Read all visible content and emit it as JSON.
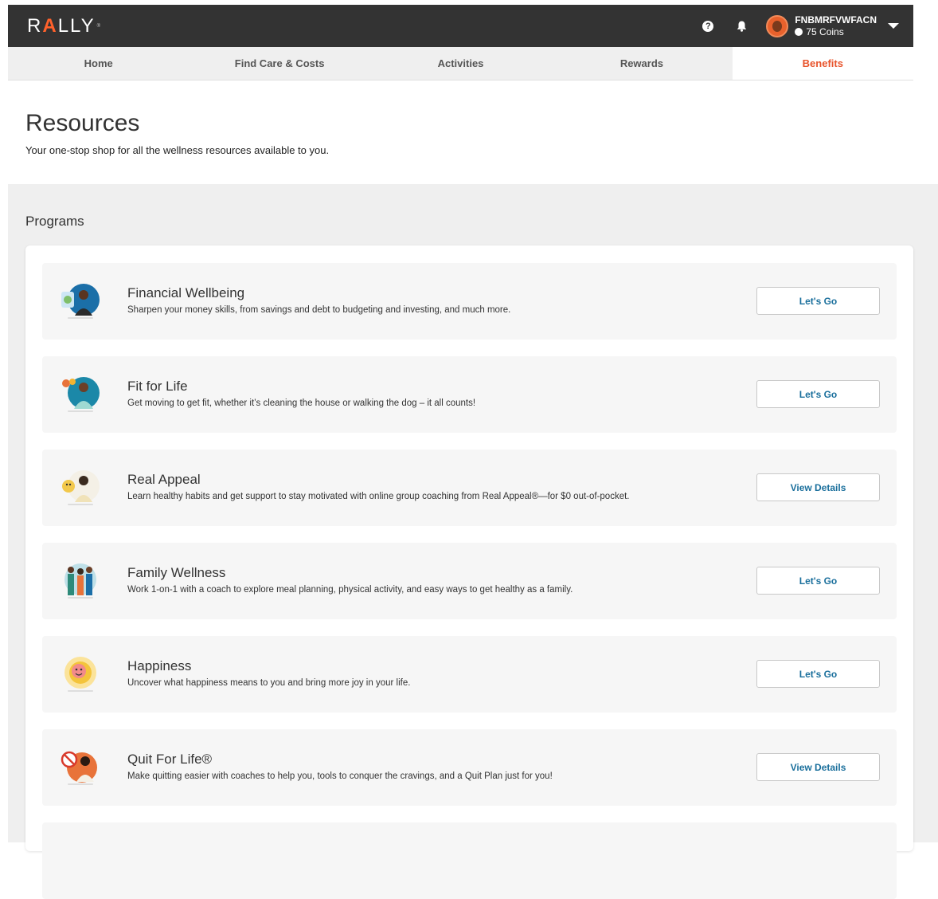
{
  "topbar": {
    "logo_pre": "R",
    "logo_a": "A",
    "logo_post": "LLY",
    "user_name": "FNBMRFVWFACN",
    "coins": "75 Coins"
  },
  "nav": [
    "Home",
    "Find Care & Costs",
    "Activities",
    "Rewards",
    "Benefits"
  ],
  "page": {
    "title": "Resources",
    "subtitle": "Your one-stop shop for all the wellness resources available to you."
  },
  "section_title": "Programs",
  "programs": [
    {
      "title": "Financial Wellbeing",
      "desc": "Sharpen your money skills, from savings and debt to budgeting and investing, and much more.",
      "button": "Let's Go",
      "icon": "financial-wellbeing-icon"
    },
    {
      "title": "Fit for Life",
      "desc": "Get moving to get fit, whether it’s cleaning the house or walking the dog – it all counts!",
      "button": "Let's Go",
      "icon": "fit-for-life-icon"
    },
    {
      "title": "Real Appeal",
      "desc": "Learn healthy habits and get support to stay motivated with online group coaching from Real Appeal®—for $0 out-of-pocket.",
      "button": "View Details",
      "icon": "real-appeal-icon"
    },
    {
      "title": "Family Wellness",
      "desc": "Work 1-on-1 with a coach to explore meal planning, physical activity, and easy ways to get healthy as a family.",
      "button": "Let's Go",
      "icon": "family-wellness-icon"
    },
    {
      "title": "Happiness",
      "desc": "Uncover what happiness means to you and bring more joy in your life.",
      "button": "Let's Go",
      "icon": "happiness-icon"
    },
    {
      "title": "Quit For Life®",
      "desc": "Make quitting easier with coaches to help you, tools to conquer the cravings, and a Quit Plan just for you!",
      "button": "View Details",
      "icon": "quit-for-life-icon"
    }
  ],
  "colors": {
    "accent": "#e8542c",
    "link": "#1a6f9c",
    "topbar": "#333333"
  }
}
